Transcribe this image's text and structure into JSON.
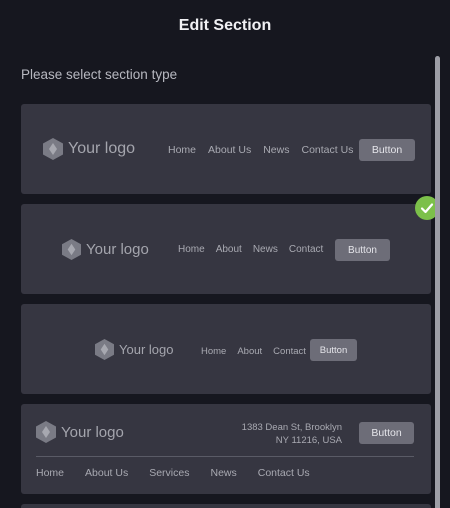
{
  "dialog": {
    "title": "Edit Section",
    "subtitle": "Please select section type"
  },
  "colors": {
    "background": "#16171f",
    "card": "#363641",
    "button": "#6d6d78",
    "selected_check": "#7cc04a"
  },
  "options": [
    {
      "logo_text": "Your logo",
      "nav": [
        "Home",
        "About Us",
        "News",
        "Contact Us"
      ],
      "button": "Button"
    },
    {
      "logo_text": "Your logo",
      "nav": [
        "Home",
        "About",
        "News",
        "Contact"
      ],
      "button": "Button",
      "selected": true
    },
    {
      "logo_text": "Your logo",
      "nav": [
        "Home",
        "About",
        "Contact"
      ],
      "button": "Button"
    },
    {
      "logo_text": "Your logo",
      "address_line1": "1383 Dean St, Brooklyn",
      "address_line2": "NY 11216, USA",
      "button": "Button",
      "nav": [
        "Home",
        "About Us",
        "Services",
        "News",
        "Contact Us"
      ]
    }
  ]
}
